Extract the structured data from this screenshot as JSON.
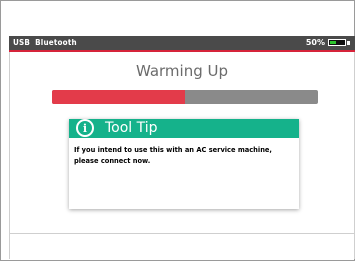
{
  "status_bar": {
    "left_items": [
      "USB",
      "Bluetooth"
    ],
    "battery_text": "50%",
    "battery_level": 0.5,
    "background_color": "#4a4a4a",
    "battery_color": "#2ec42e"
  },
  "accent_line_color": "#d6243a",
  "title": "Warming Up",
  "progress": {
    "value": 0.5,
    "fill_color": "#e33b4a",
    "track_color": "#8a8a8a"
  },
  "tooltip": {
    "icon": "info-icon",
    "title": "Tool Tip",
    "body": "If you intend to use this with an AC service machine, please connect now.",
    "header_color": "#15b28b"
  }
}
